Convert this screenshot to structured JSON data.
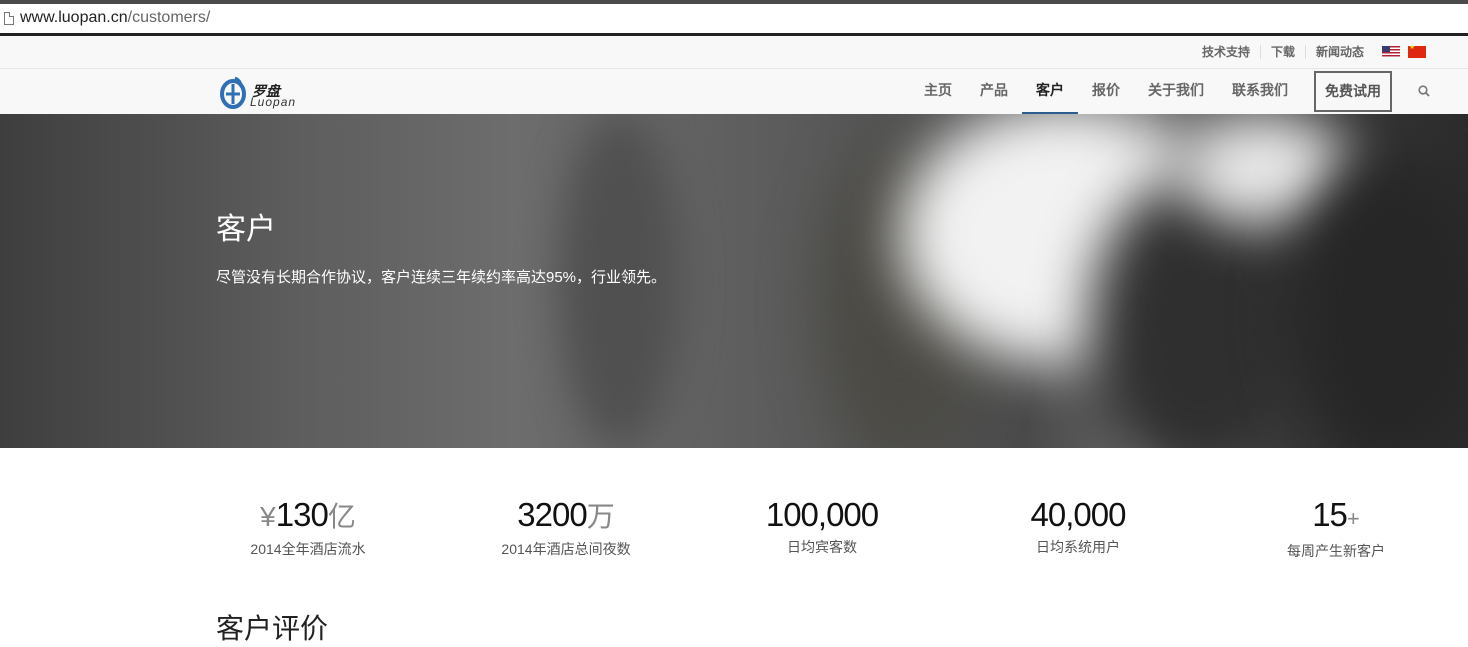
{
  "browser": {
    "url_host": "www.luopan.cn",
    "url_path": "/customers/"
  },
  "utility_links": [
    {
      "label": "技术支持"
    },
    {
      "label": "下载"
    },
    {
      "label": "新闻动态"
    }
  ],
  "logo": {
    "cn": "罗盘",
    "en": "Luopan"
  },
  "nav": {
    "items": [
      {
        "label": "主页",
        "active": false
      },
      {
        "label": "产品",
        "active": false
      },
      {
        "label": "客户",
        "active": true
      },
      {
        "label": "报价",
        "active": false
      },
      {
        "label": "关于我们",
        "active": false
      },
      {
        "label": "联系我们",
        "active": false
      }
    ],
    "trial_label": "免费试用",
    "active_color": "#2c5d8f"
  },
  "hero": {
    "title": "客户",
    "subtitle": "尽管没有长期合作协议，客户连续三年续约率高达95%，行业领先。"
  },
  "stats": [
    {
      "prefix": "¥",
      "value": "130",
      "suffix": "亿",
      "label": "2014全年酒店流水"
    },
    {
      "prefix": "",
      "value": "3200",
      "suffix": "万",
      "label": "2014年酒店总间夜数"
    },
    {
      "prefix": "",
      "value": "100,000",
      "suffix": "",
      "label": "日均宾客数"
    },
    {
      "prefix": "",
      "value": "40,000",
      "suffix": "",
      "label": "日均系统用户"
    },
    {
      "prefix": "",
      "value": "15",
      "suffix": "+",
      "label": "每周产生新客户"
    }
  ],
  "section": {
    "title": "客户评价"
  }
}
